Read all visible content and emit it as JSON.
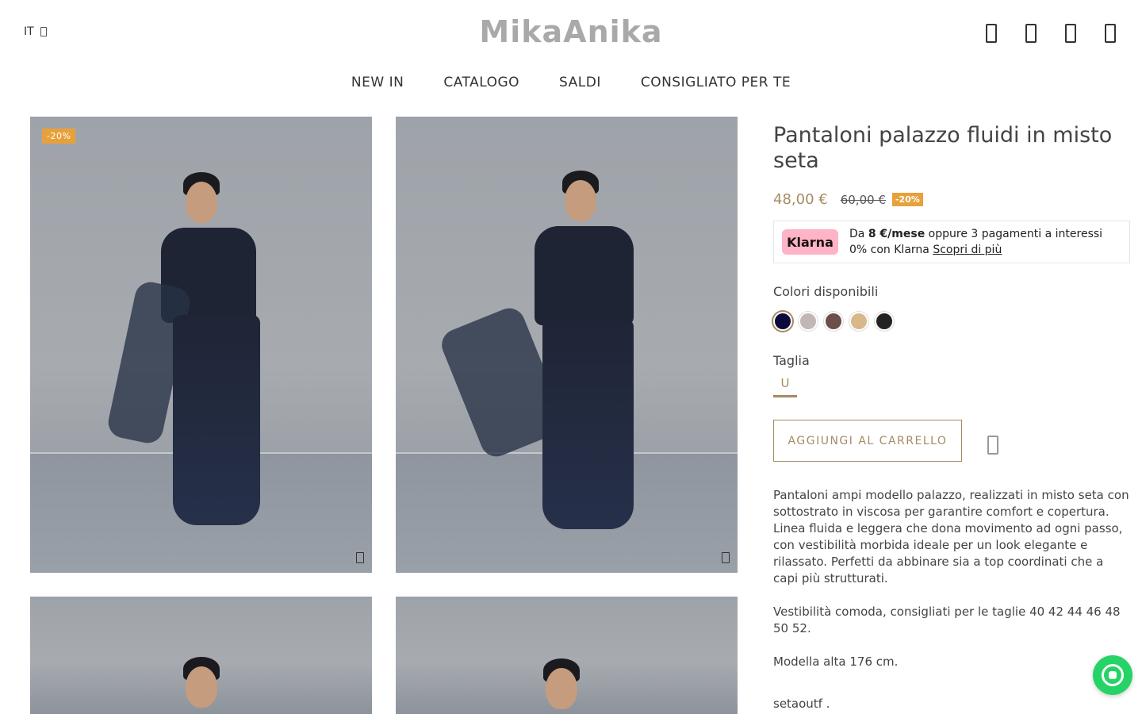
{
  "header": {
    "language": "IT",
    "logo": "MikaAnika",
    "icons": [
      "search-icon",
      "account-icon",
      "wishlist-icon",
      "cart-icon"
    ]
  },
  "nav": {
    "items": [
      "NEW IN",
      "CATALOGO",
      "SALDI",
      "CONSIGLIATO PER TE"
    ]
  },
  "gallery": {
    "discount_badge": "-20%"
  },
  "product": {
    "title": "Pantaloni palazzo fluidi in misto seta",
    "price": "48,00 €",
    "old_price": "60,00 €",
    "discount": "-20%",
    "klarna": {
      "logo": "Klarna",
      "prefix": "Da ",
      "amount": "8 €/mese",
      "suffix": " oppure 3 pagamenti a interessi 0% con Klarna ",
      "link": "Scopri di più"
    },
    "colors_label": "Colori disponibili",
    "colors": [
      "#0b0b3b",
      "#c2b7b4",
      "#6b4f4a",
      "#d8b78a",
      "#222222"
    ],
    "size_label": "Taglia",
    "size": "U",
    "add_to_cart": "AGGIUNGI AL CARRELLO",
    "description": [
      "Pantaloni ampi modello palazzo, realizzati in misto seta con sottostrato in viscosa per garantire comfort e copertura. Linea fluida e leggera che dona movimento ad ogni passo, con vestibilità morbida ideale per un look elegante e rilassato. Perfetti da abbinare sia a top coordinati che a capi più strutturati.",
      "Vestibilità comoda, consigliati per le taglie 40 42 44 46 48 50 52.",
      "Modella alta 176 cm.",
      "setaoutf ."
    ]
  }
}
